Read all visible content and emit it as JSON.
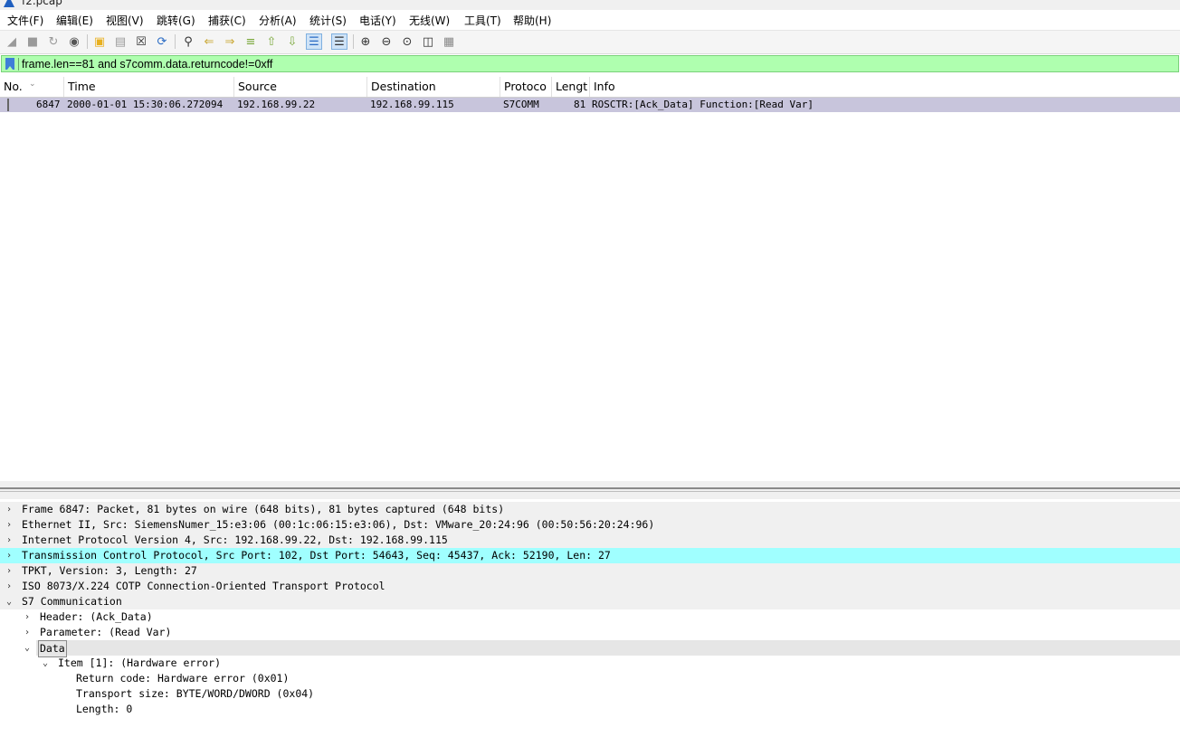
{
  "window": {
    "title": "f2.pcap"
  },
  "menu": [
    "文件(F)",
    "编辑(E)",
    "视图(V)",
    "跳转(G)",
    "捕获(C)",
    "分析(A)",
    "统计(S)",
    "电话(Y)",
    "无线(W)",
    "工具(T)",
    "帮助(H)"
  ],
  "toolbar": {
    "icons": [
      "shark-fin-start-icon",
      "stop-icon",
      "restart-icon",
      "capture-options-icon",
      "open-folder-icon",
      "save-icon",
      "close-file-icon",
      "reload-icon",
      "find-icon",
      "back-arrow-icon",
      "forward-arrow-icon",
      "go-to-packet-icon",
      "first-packet-icon",
      "last-packet-icon",
      "autoscroll-icon",
      "colorize-icon",
      "zoom-in-icon",
      "zoom-out-icon",
      "normal-size-icon",
      "resize-columns-icon",
      "layout-icon"
    ]
  },
  "filter": {
    "value": "frame.len==81 and s7comm.data.returncode!=0xff"
  },
  "columns": [
    "No.",
    "Time",
    "Source",
    "Destination",
    "Protoco",
    "Lengt",
    "Info"
  ],
  "packets": [
    {
      "no": "6847",
      "time": "2000-01-01 15:30:06.272094",
      "source": "192.168.99.22",
      "destination": "192.168.99.115",
      "protocol": "S7COMM",
      "length": "81",
      "info": "ROSCTR:[Ack_Data] Function:[Read Var]"
    }
  ],
  "details": [
    {
      "text": "Frame 6847: Packet, 81 bytes on wire (648 bits), 81 bytes captured (648 bits)",
      "expander": ">"
    },
    {
      "text": "Ethernet II, Src: SiemensNumer_15:e3:06 (00:1c:06:15:e3:06), Dst: VMware_20:24:96 (00:50:56:20:24:96)",
      "expander": ">"
    },
    {
      "text": "Internet Protocol Version 4, Src: 192.168.99.22, Dst: 192.168.99.115",
      "expander": ">"
    },
    {
      "text": "Transmission Control Protocol, Src Port: 102, Dst Port: 54643, Seq: 45437, Ack: 52190, Len: 27",
      "expander": ">"
    },
    {
      "text": "TPKT, Version: 3, Length: 27",
      "expander": ">"
    },
    {
      "text": "ISO 8073/X.224 COTP Connection-Oriented Transport Protocol",
      "expander": ">"
    },
    {
      "text": "S7 Communication",
      "expander": "v"
    },
    {
      "text": "Header: (Ack_Data)",
      "expander": ">"
    },
    {
      "text": "Parameter: (Read Var)",
      "expander": ">"
    },
    {
      "text": "Data",
      "expander": "v"
    },
    {
      "text": "Item [1]: (Hardware error)",
      "expander": "v"
    },
    {
      "text": "Return code: Hardware error (0x01)",
      "expander": ""
    },
    {
      "text": "Transport size: BYTE/WORD/DWORD (0x04)",
      "expander": ""
    },
    {
      "text": "Length: 0",
      "expander": ""
    }
  ],
  "colors": {
    "filter_bg": "#afffaf",
    "selected_row": "#c8c5dc",
    "tcp_highlight": "#a0ffff"
  }
}
